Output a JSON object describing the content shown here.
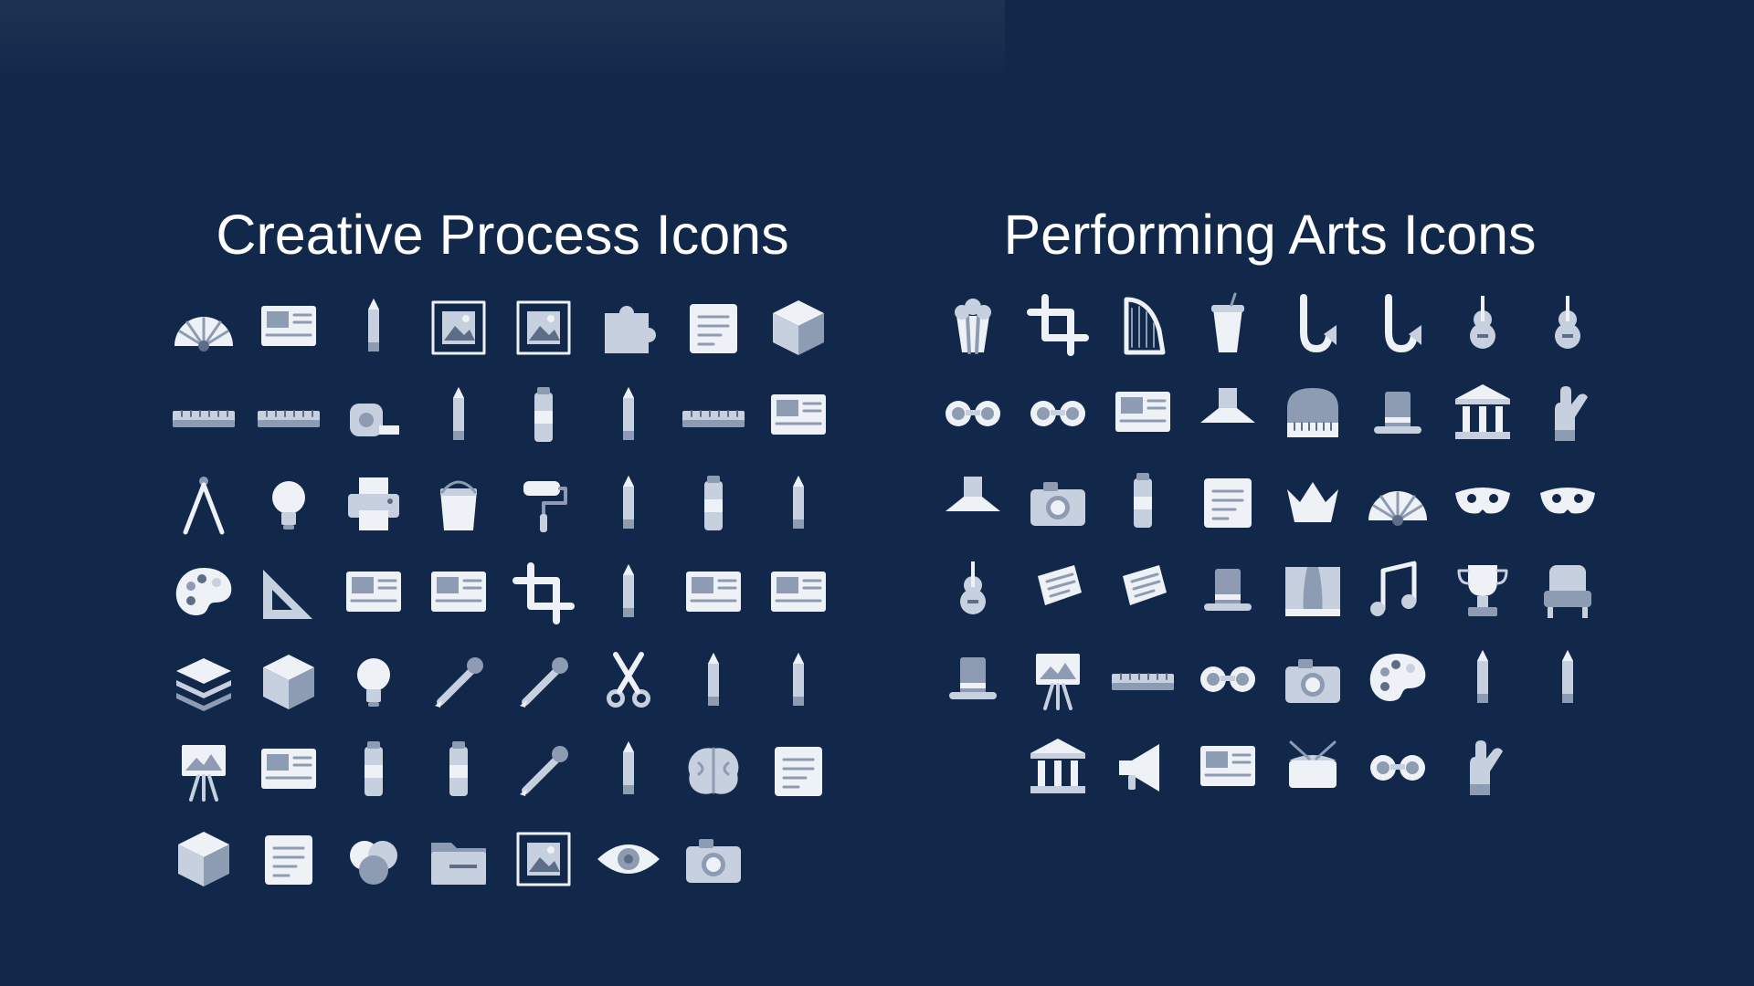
{
  "left": {
    "title": "Creative Process Icons",
    "icons": [
      [
        "protractor-icon",
        "presentation-board-icon",
        "tape-dispenser-icon",
        "text-tool-icon",
        "image-frame-icon",
        "puzzle-icon",
        "scroll-icon",
        "cube-icon"
      ],
      [
        "ruler-icon",
        "caliper-icon",
        "tape-measure-icon",
        "feather-icon",
        "paint-tube-icon",
        "paintbrush-icon",
        "keyboard-blueprint-icon",
        "floor-plan-icon"
      ],
      [
        "compass-tool-icon",
        "mind-idea-icon",
        "printer-icon",
        "paint-bucket-icon",
        "paint-roller-icon",
        "brush-icon",
        "glue-stick-icon",
        "pencil-icon"
      ],
      [
        "palette-icon",
        "set-square-icon",
        "wireframe-icon",
        "browser-window-icon",
        "crop-icon",
        "airbrush-icon",
        "swatch-tray-icon",
        "graphics-tablet-icon"
      ],
      [
        "layers-icon",
        "crayon-box-icon",
        "lightbulb-icon",
        "dropper-icon",
        "magic-wand-icon",
        "scissors-icon",
        "hand-pen-icon",
        "pen-tool-icon"
      ],
      [
        "easel-icon",
        "color-swatches-icon",
        "tube-icon",
        "spray-can-icon",
        "utility-knife-icon",
        "pencil-upright-icon",
        "brain-icon",
        "sketchpad-icon"
      ],
      [
        "box-3d-icon",
        "checklist-icon",
        "color-mix-icon",
        "folder-icon",
        "search-image-icon",
        "eye-icon",
        "camera-icon"
      ]
    ]
  },
  "right": {
    "title": "Performing Arts Icons",
    "icons": [
      [
        "popcorn-icon",
        "microphone-icon",
        "harp-icon",
        "soda-cup-icon",
        "saxophone-icon",
        "trumpet-icon",
        "violin-icon",
        "guitar-icon"
      ],
      [
        "glasses-mustache-icon",
        "opera-glasses-icon",
        "cinema-screen-icon",
        "ballet-tutu-icon",
        "grand-piano-icon",
        "magic-hat-icon",
        "column-icon",
        "clapping-hands-icon"
      ],
      [
        "ballet-shoe-icon",
        "film-camera-icon",
        "mask-on-stick-icon",
        "script-icon",
        "crown-icon",
        "hand-fan-icon",
        "carnival-mask-icon",
        "theatre-masks-icon"
      ],
      [
        "electric-guitar-icon",
        "vip-ticket-icon",
        "ticket-icon",
        "top-hat-icon",
        "stage-curtain-icon",
        "music-notes-icon",
        "trophy-icon",
        "theatre-seat-icon"
      ],
      [
        "hat-bowtie-icon",
        "easel-painting-icon",
        "synthesizer-icon",
        "3d-glasses-icon",
        "photo-camera-icon",
        "paint-palette-icon",
        "quill-icon",
        "open-book-icon"
      ],
      [
        "museum-icon",
        "megaphone-icon",
        "video-player-icon",
        "drum-icon",
        "binoculars-icon",
        "handheld-mic-icon"
      ]
    ]
  },
  "colors": {
    "background": "#11284a",
    "light": "#eef1f6",
    "mid": "#c7d0de",
    "dark": "#8d9bb3",
    "deep": "#5d6d88"
  }
}
